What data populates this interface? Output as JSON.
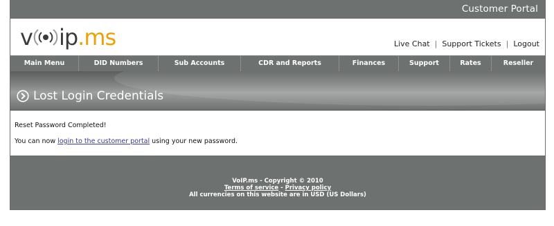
{
  "header": {
    "portal_title": "Customer Portal",
    "logo": {
      "prefix": "v",
      "middle": "ip",
      "dot": ".",
      "suffix": "ms"
    },
    "links": {
      "live_chat": "Live Chat",
      "support_tickets": "Support Tickets",
      "logout": "Logout",
      "separator": "|"
    }
  },
  "nav": {
    "items": [
      {
        "label": "Main Menu"
      },
      {
        "label": "DID Numbers"
      },
      {
        "label": "Sub Accounts"
      },
      {
        "label": "CDR and Reports"
      },
      {
        "label": "Finances"
      },
      {
        "label": "Support"
      },
      {
        "label": "Rates"
      },
      {
        "label": "Reseller"
      }
    ]
  },
  "banner": {
    "title": "Lost Login Credentials"
  },
  "content": {
    "status": "Reset Password Completed!",
    "message_prefix": "You can now ",
    "message_link": "login to the customer portal",
    "message_suffix": " using your new password."
  },
  "footer": {
    "copyright": "VoIP.ms - Copyright © 2010",
    "terms": "Terms of service",
    "dash": " - ",
    "privacy": "Privacy policy",
    "currency_note": "All currencies on this website are in USD (US Dollars)"
  },
  "colors": {
    "bar_gray": "#6d716f",
    "logo_accent": "#e8a20a",
    "link": "#3a3a8a"
  }
}
